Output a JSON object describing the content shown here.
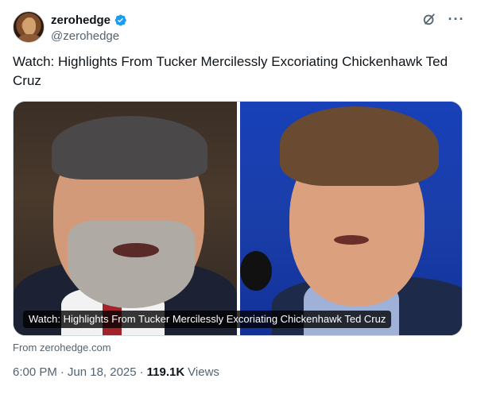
{
  "author": {
    "display_name": "zerohedge",
    "handle": "@zerohedge",
    "verified": true,
    "verified_color": "#1d9bf0"
  },
  "header_actions": {
    "grok_icon": "grok-icon",
    "more_label": "···"
  },
  "tweet": {
    "text": "Watch: Highlights From Tucker Mercilessly Excoriating Chickenhawk Ted Cruz"
  },
  "card": {
    "caption": "Watch: Highlights From Tucker Mercilessly Excoriating Chickenhawk Ted Cruz",
    "source": "From zerohedge.com"
  },
  "meta": {
    "time": "6:00 PM",
    "separator1": "·",
    "date": "Jun 18, 2025",
    "separator2": "·",
    "views_count": "119.1K",
    "views_label": "Views"
  }
}
